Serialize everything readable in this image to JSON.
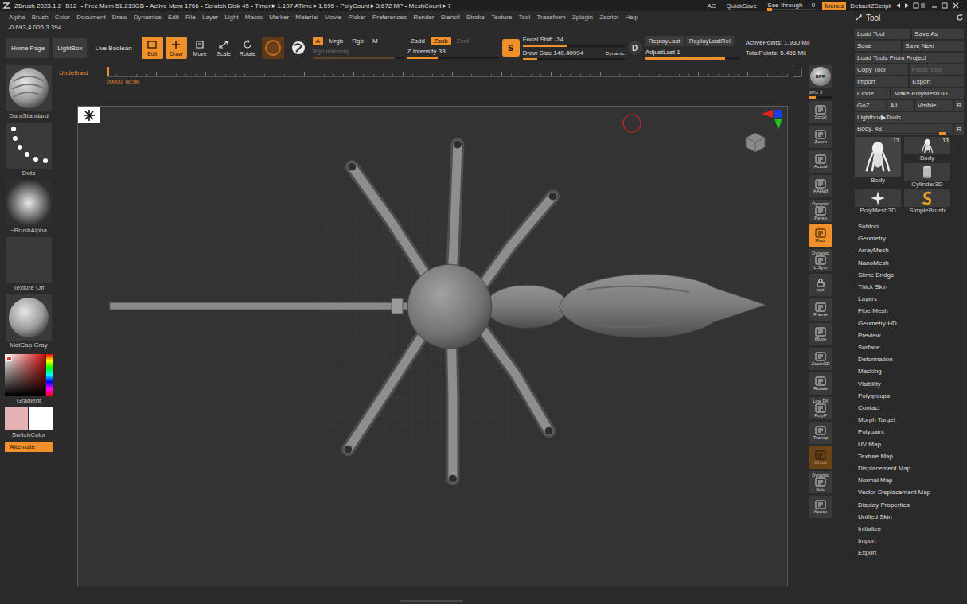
{
  "title_bar": {
    "app": "ZBrush 2023.1.2",
    "build": "B12",
    "stats": "• Free Mem 51.219GB • Active Mem 1766 • Scratch Disk 45 • Timer►1.197 ATime►1.595 • PolyCount►3.672 MP • MeshCount►7",
    "buttons": [
      {
        "label": "AC",
        "selected": false
      },
      {
        "label": "QuickSave",
        "selected": false
      }
    ],
    "see_through": {
      "label": "See-through",
      "value": "0",
      "level": 0
    },
    "menus": {
      "label": "Menus",
      "selected": true
    },
    "script": "DefaultZScript"
  },
  "menu_bar": [
    "Alpha",
    "Brush",
    "Color",
    "Document",
    "Draw",
    "Dynamics",
    "Edit",
    "File",
    "Layer",
    "Light",
    "Macro",
    "Marker",
    "Material",
    "Movie",
    "Picker",
    "Preferences",
    "Render",
    "Stencil",
    "Stroke",
    "Texture",
    "Tool",
    "Transform",
    "Zplugin",
    "Zscript",
    "Help"
  ],
  "coordinates": "-0.693,4.005,3.394",
  "shelf": {
    "nav_buttons": [
      {
        "label": "Home Page"
      },
      {
        "label": "LightBox"
      },
      {
        "label": "Live Boolean"
      }
    ],
    "modes": [
      {
        "label": "Edit",
        "selected": true
      },
      {
        "label": "Draw",
        "selected": true
      },
      {
        "label": "Move",
        "selected": false
      },
      {
        "label": "Scale",
        "selected": false
      },
      {
        "label": "Rotate",
        "selected": false
      }
    ],
    "color_modes": [
      {
        "label": "A",
        "selected": true
      },
      {
        "label": "Mrgb",
        "selected": false
      },
      {
        "label": "Rgb",
        "selected": false
      },
      {
        "label": "M",
        "selected": false
      }
    ],
    "rgb_intensity": {
      "label": "Rgb Intensity",
      "level": 0.9,
      "disabled": true
    },
    "z_modes": [
      {
        "label": "Zadd",
        "selected": false,
        "disabled": false
      },
      {
        "label": "Zsub",
        "selected": true,
        "disabled": false
      },
      {
        "label": "Zcut",
        "selected": false,
        "disabled": true
      }
    ],
    "z_intensity": {
      "label": "Z Intensity 33",
      "level": 0.33,
      "disabled": false
    },
    "sculptris": {
      "label": "S",
      "selected": true
    },
    "focal_shift": {
      "label": "Focal Shift -14",
      "level": 0.43,
      "disabled": false
    },
    "draw_size": {
      "label": "Draw Size 140.40994",
      "level": 0.14,
      "disabled": false
    },
    "dynamic": "Dynamic",
    "draw_dynamic": {
      "label": "D",
      "selected": false
    },
    "replay": [
      {
        "label": "ReplayLast"
      },
      {
        "label": "ReplayLastRel"
      }
    ],
    "adjust_last": {
      "label": "AdjustLast 1",
      "level": 0.85,
      "disabled": false
    },
    "points": [
      "ActivePoints: 1.930 Mil",
      "TotalPoints: 5.456 Mil"
    ]
  },
  "timeline": {
    "label": "Undefined",
    "frame": "00000",
    "time": "00:00",
    "level": 0
  },
  "left_shelf": {
    "items": [
      {
        "label": "DamStandard",
        "kind": "brush"
      },
      {
        "label": "Dots",
        "kind": "stroke"
      },
      {
        "label": "~BrushAlpha",
        "kind": "alpha"
      },
      {
        "label": "Texture Off",
        "kind": "texture"
      },
      {
        "label": "MatCap Gray",
        "kind": "material"
      }
    ],
    "gradient": "Gradient",
    "main_color": "#e6b2b4",
    "secondary_color": "#ffffff",
    "switch_color": "SwitchColor",
    "alternate": {
      "label": "Alternate",
      "selected": true
    }
  },
  "right_shelf": {
    "bpr": "BPR",
    "spix": {
      "label": "SPix 3",
      "level": 0.3
    },
    "items": [
      {
        "label": "Scroll",
        "sub": "",
        "kind": "button",
        "selected": false,
        "dimmed": false
      },
      {
        "label": "Zoom",
        "sub": "",
        "kind": "button",
        "selected": false,
        "dimmed": false
      },
      {
        "label": "Actual",
        "sub": "",
        "kind": "button",
        "selected": false,
        "dimmed": false
      },
      {
        "label": "AAHalf",
        "sub": "",
        "kind": "button",
        "selected": false,
        "dimmed": false
      },
      {
        "label": "Persp",
        "sub": "Dynamic",
        "kind": "button",
        "selected": false,
        "dimmed": false
      },
      {
        "label": "Floor",
        "sub": "",
        "kind": "button",
        "selected": true,
        "dimmed": false
      },
      {
        "label": "L.Sym",
        "sub": "Dynamic",
        "kind": "button",
        "selected": false,
        "dimmed": false
      },
      {
        "label": "xyz",
        "sub": "",
        "kind": "lock",
        "selected": false,
        "dimmed": false
      },
      {
        "label": "Frame",
        "sub": "",
        "kind": "button",
        "selected": false,
        "dimmed": false
      },
      {
        "label": "Move",
        "sub": "",
        "kind": "button",
        "selected": false,
        "dimmed": false
      },
      {
        "label": "Zoom3D",
        "sub": "",
        "kind": "button",
        "selected": false,
        "dimmed": false
      },
      {
        "label": "Rotate",
        "sub": "",
        "kind": "button",
        "selected": false,
        "dimmed": false
      },
      {
        "label": "PolyF",
        "sub": "Line Fill",
        "kind": "button",
        "selected": false,
        "dimmed": false
      },
      {
        "label": "Transp",
        "sub": "",
        "kind": "button",
        "selected": false,
        "dimmed": false
      },
      {
        "label": "Ghost",
        "sub": "",
        "kind": "button",
        "selected": true,
        "dimmed": true
      },
      {
        "label": "Solo",
        "sub": "Dynamic",
        "kind": "button",
        "selected": false,
        "dimmed": false
      },
      {
        "label": "Xpose",
        "sub": "",
        "kind": "button",
        "selected": false,
        "dimmed": false
      }
    ]
  },
  "tool_panel": {
    "title": "Tool",
    "button_rows": [
      [
        {
          "label": "Load Tool",
          "disabled": false
        },
        {
          "label": "Save As",
          "disabled": false
        }
      ],
      [
        {
          "label": "Save",
          "disabled": false
        },
        {
          "label": "Save Next",
          "disabled": false
        }
      ],
      [
        {
          "label": "Load Tools From Project",
          "disabled": false
        }
      ],
      [
        {
          "label": "Copy Tool",
          "disabled": false
        },
        {
          "label": "Paste Tool",
          "disabled": true
        }
      ],
      [
        {
          "label": "Import",
          "disabled": false
        },
        {
          "label": "Export",
          "disabled": false
        }
      ],
      [
        {
          "label": "Clone",
          "disabled": false
        },
        {
          "label": "Make PolyMesh3D",
          "disabled": false
        }
      ],
      [
        {
          "label": "GoZ",
          "disabled": false
        },
        {
          "label": "All",
          "disabled": false
        },
        {
          "label": "Visible",
          "disabled": false
        },
        {
          "label": "R",
          "disabled": false
        }
      ],
      [
        {
          "label": "Lightbox▶Tools",
          "disabled": false
        }
      ]
    ],
    "tool_slider": {
      "label": "Body. 48",
      "level": 0.95,
      "reset": "R"
    },
    "thumbnails": [
      {
        "label": "Body",
        "count": "13",
        "kind": "large",
        "selected": true
      },
      {
        "label": "Body",
        "count": "13",
        "kind": "small",
        "selected": false
      },
      {
        "label": "Cylinder3D",
        "count": "",
        "kind": "small",
        "selected": false
      },
      {
        "label": "PolyMesh3D",
        "count": "",
        "kind": "small",
        "selected": false
      },
      {
        "label": "SimpleBrush",
        "count": "",
        "kind": "small",
        "selected": false
      }
    ],
    "sections": [
      "Subtool",
      "Geometry",
      "ArrayMesh",
      "NanoMesh",
      "Slime Bridge",
      "Thick Skin",
      "Layers",
      "FiberMesh",
      "Geometry HD",
      "Preview",
      "Surface",
      "Deformation",
      "Masking",
      "Visibility",
      "Polygroups",
      "Contact",
      "Morph Target",
      "Polypaint",
      "UV Map",
      "Texture Map",
      "Displacement Map",
      "Normal Map",
      "Vector Displacement Map",
      "Display Properties",
      "Unified Skin",
      "Initialize",
      "Import",
      "Export"
    ]
  }
}
